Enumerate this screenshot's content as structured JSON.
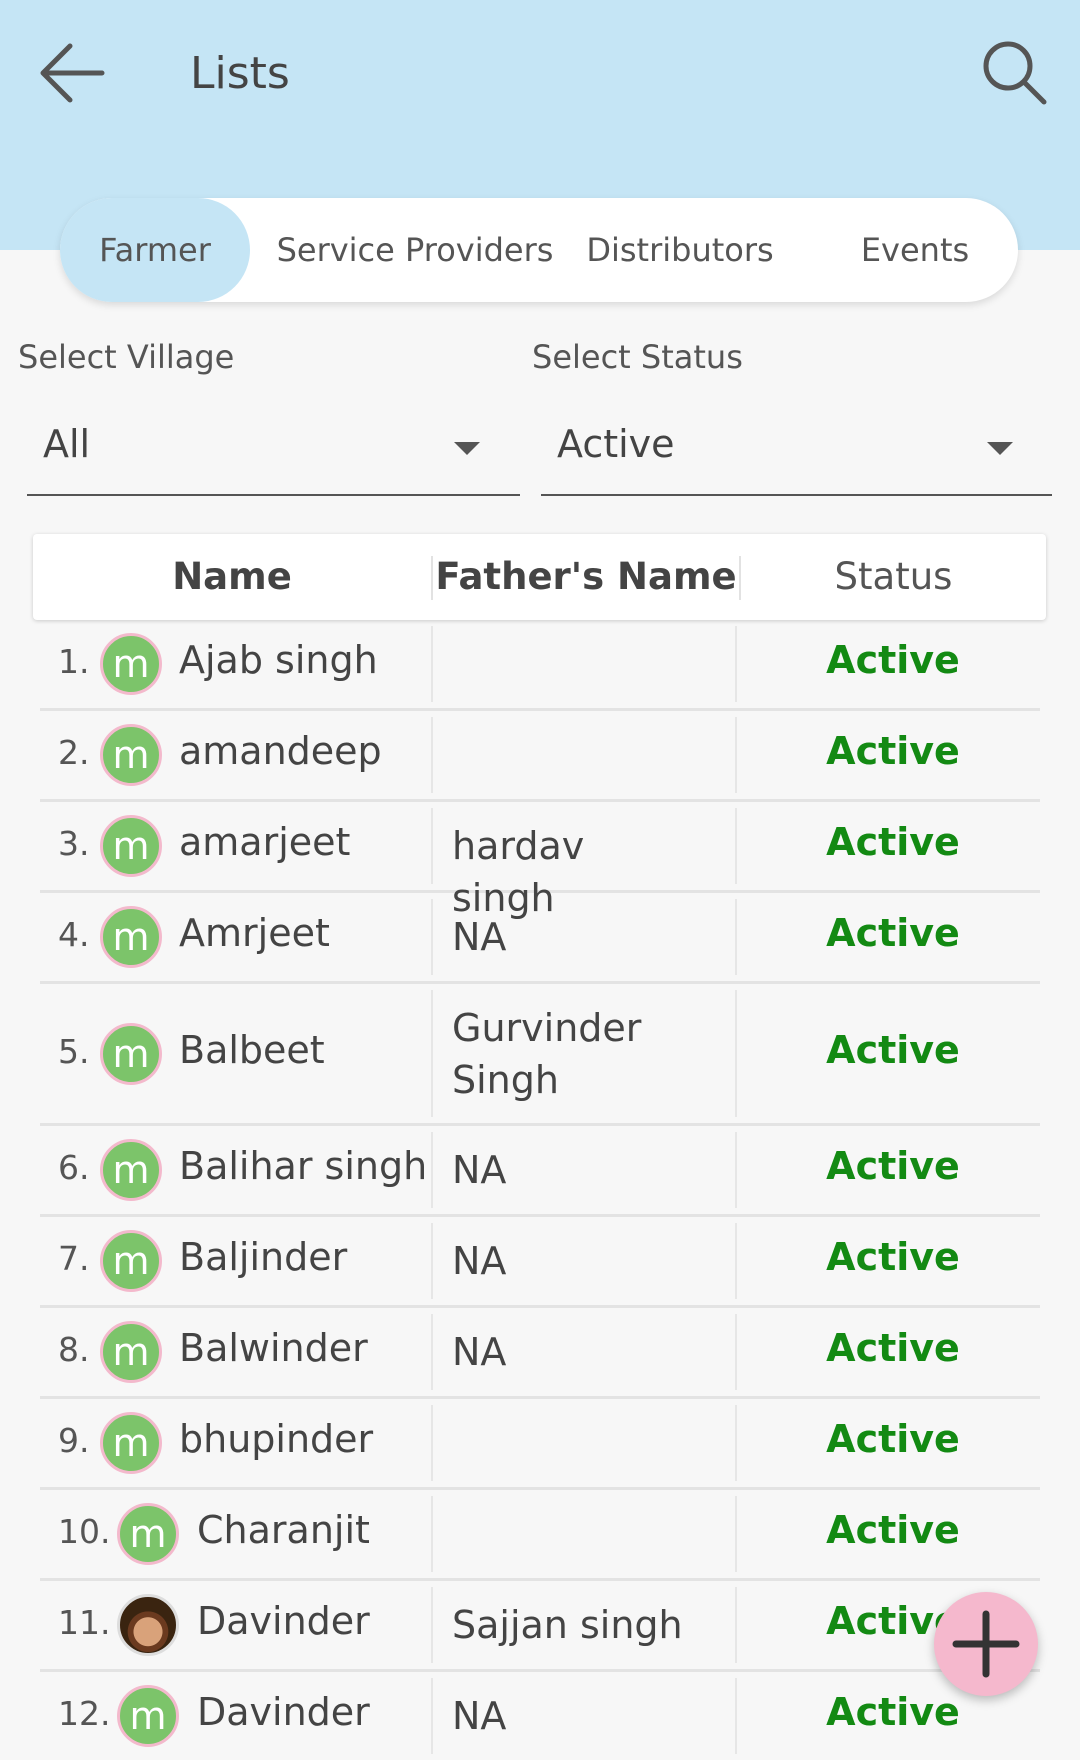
{
  "header": {
    "title": "Lists",
    "back_icon": "arrow-left-icon",
    "search_icon": "search-icon",
    "background": "#c5e5f5"
  },
  "tabs": [
    {
      "label": "Farmer",
      "active": true
    },
    {
      "label": "Service Providers",
      "active": false
    },
    {
      "label": "Distributors",
      "active": false
    },
    {
      "label": "Events",
      "active": false
    }
  ],
  "filters": {
    "village": {
      "label": "Select Village",
      "value": "All"
    },
    "status": {
      "label": "Select Status",
      "value": "Active"
    }
  },
  "table": {
    "columns": [
      "Name",
      "Father's Name",
      "Status"
    ],
    "rows": [
      {
        "num": "1.",
        "avatar": "m",
        "name": "Ajab singh",
        "father": "",
        "status": "Active"
      },
      {
        "num": "2.",
        "avatar": "m",
        "name": "amandeep",
        "father": "",
        "status": "Active"
      },
      {
        "num": "3.",
        "avatar": "m",
        "name": "amarjeet",
        "father": "hardav singh",
        "status": "Active"
      },
      {
        "num": "4.",
        "avatar": "m",
        "name": "Amrjeet",
        "father": "NA",
        "status": "Active"
      },
      {
        "num": "5.",
        "avatar": "m",
        "name": "Balbeet",
        "father": "Gurvinder Singh",
        "status": "Active"
      },
      {
        "num": "6.",
        "avatar": "m",
        "name": "Balihar singh",
        "father": "NA",
        "status": "Active"
      },
      {
        "num": "7.",
        "avatar": "m",
        "name": "Baljinder",
        "father": "NA",
        "status": "Active"
      },
      {
        "num": "8.",
        "avatar": "m",
        "name": "Balwinder",
        "father": "NA",
        "status": "Active"
      },
      {
        "num": "9.",
        "avatar": "m",
        "name": "bhupinder",
        "father": "",
        "status": "Active"
      },
      {
        "num": "10.",
        "avatar": "m",
        "name": "Charanjit",
        "father": "",
        "status": "Active"
      },
      {
        "num": "11.",
        "avatar": "photo",
        "name": "Davinder",
        "father": "Sajjan singh",
        "status": "Active"
      },
      {
        "num": "12.",
        "avatar": "m",
        "name": "Davinder",
        "father": "NA",
        "status": "Active"
      }
    ]
  },
  "fab": {
    "icon": "plus-icon",
    "color": "#f5b8cd"
  },
  "colors": {
    "status_active": "#138a13",
    "avatar_bg": "#7cc46a",
    "avatar_ring": "#f3b9cc"
  }
}
